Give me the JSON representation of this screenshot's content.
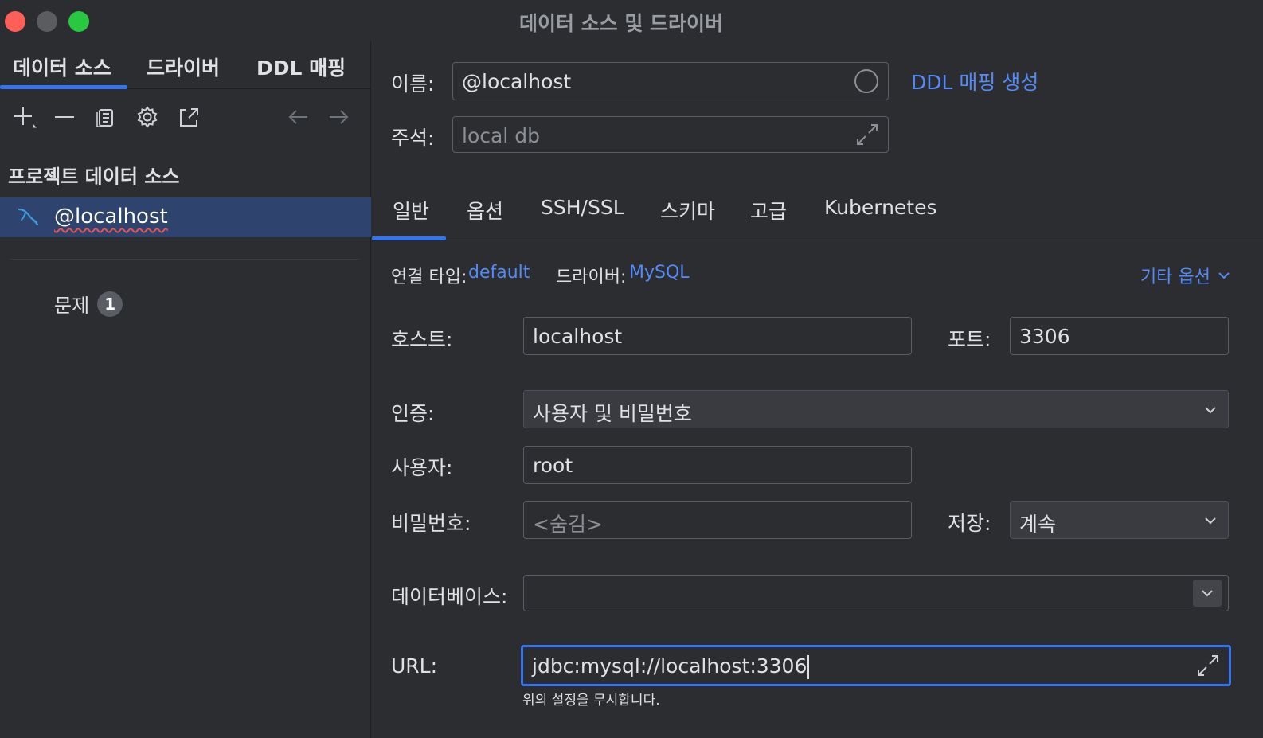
{
  "window": {
    "title": "데이터 소스 및 드라이버"
  },
  "left": {
    "tabs": [
      {
        "label": "데이터 소스"
      },
      {
        "label": "드라이버"
      },
      {
        "label": "DDL 매핑"
      }
    ],
    "section_title": "프로젝트 데이터 소스",
    "datasource": {
      "label": "@localhost",
      "icon": "mysql-dolphin-icon"
    },
    "problems": {
      "label": "문제",
      "count": "1"
    }
  },
  "right": {
    "name": {
      "label": "이름:",
      "value": "@localhost"
    },
    "ddl_link": "DDL 매핑 생성",
    "comment": {
      "label": "주석:",
      "value": "local db"
    },
    "tabs": [
      {
        "label": "일반"
      },
      {
        "label": "옵션"
      },
      {
        "label": "SSH/SSL"
      },
      {
        "label": "스키마"
      },
      {
        "label": "고급"
      },
      {
        "label": "Kubernetes"
      }
    ],
    "connection_type": {
      "label": "연결 타입:",
      "value": "default"
    },
    "driver": {
      "label": "드라이버:",
      "value": "MySQL"
    },
    "more_options": "기타 옵션",
    "host": {
      "label": "호스트:",
      "value": "localhost"
    },
    "port": {
      "label": "포트:",
      "value": "3306"
    },
    "auth": {
      "label": "인증:",
      "value": "사용자 및 비밀번호"
    },
    "user": {
      "label": "사용자:",
      "value": "root"
    },
    "password": {
      "label": "비밀번호:",
      "placeholder": "<숨김>"
    },
    "save": {
      "label": "저장:",
      "value": "계속"
    },
    "database": {
      "label": "데이터베이스:",
      "value": ""
    },
    "url": {
      "label": "URL:",
      "value": "jdbc:mysql://localhost:3306",
      "hint": "위의 설정을 무시합니다."
    }
  },
  "colors": {
    "accent": "#3574f0",
    "link": "#548af7",
    "selection": "#2e436e",
    "error_underline": "#e55353"
  }
}
